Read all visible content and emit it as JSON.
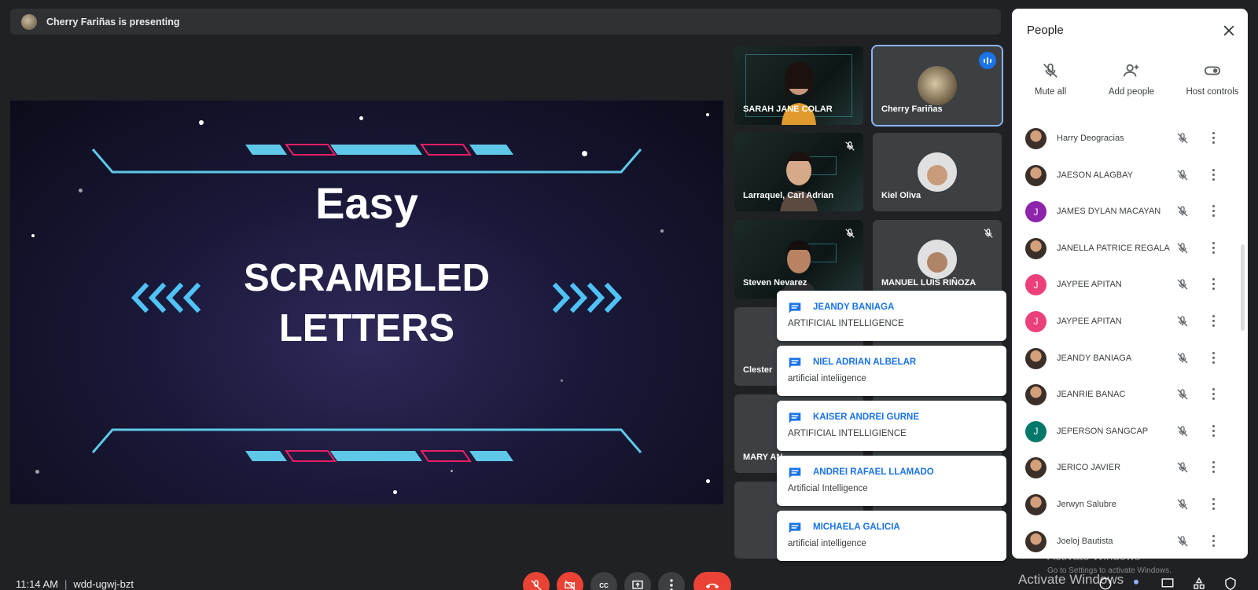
{
  "presenting_bar": {
    "text": "Cherry Fariñas is presenting"
  },
  "slide": {
    "title": "Easy",
    "line1": "SCRAMBLED",
    "line2": "LETTERS"
  },
  "tiles": [
    {
      "name": "SARAH JANE COLAR"
    },
    {
      "name": "Cherry Fariñas"
    },
    {
      "name": "Larraquel, Carl Adrian"
    },
    {
      "name": "Kiel Oliva"
    },
    {
      "name": "Steven Nevarez"
    },
    {
      "name": "MANUEL LUIS RIÑOZA"
    },
    {
      "name": "Clester"
    },
    {
      "name": "MARY AN"
    }
  ],
  "notifications": [
    {
      "name": "JEANDY BANIAGA",
      "message": "ARTIFICIAL INTELLIGENCE"
    },
    {
      "name": "NIEL ADRIAN ALBELAR",
      "message": "artificial inteliigence"
    },
    {
      "name": "KAISER ANDREI GURNE",
      "message": "ARTIFICIAL INTELLIGIENCE"
    },
    {
      "name": "ANDREI RAFAEL LLAMADO",
      "message": "Artificial Intelligence"
    },
    {
      "name": "MICHAELA GALICIA",
      "message": "artificial intelligence"
    }
  ],
  "people_panel": {
    "title": "People",
    "actions": {
      "mute_all": "Mute all",
      "add_people": "Add people",
      "host_controls": "Host controls"
    },
    "people": [
      {
        "name": "Harry Deogracias",
        "avatar": "photo",
        "initial": ""
      },
      {
        "name": "JAESON ALAGBAY",
        "avatar": "photo",
        "initial": ""
      },
      {
        "name": "JAMES DYLAN MACAYAN",
        "avatar": "initial",
        "initial": "J",
        "color": "#8e24aa"
      },
      {
        "name": "JANELLA PATRICE REGALA",
        "avatar": "photo",
        "initial": ""
      },
      {
        "name": "JAYPEE APITAN",
        "avatar": "initial",
        "initial": "J",
        "color": "#ec407a"
      },
      {
        "name": "JAYPEE APITAN",
        "avatar": "initial",
        "initial": "J",
        "color": "#ec407a"
      },
      {
        "name": "JEANDY BANIAGA",
        "avatar": "photo",
        "initial": ""
      },
      {
        "name": "JEANRIE BANAC",
        "avatar": "photo",
        "initial": ""
      },
      {
        "name": "JEPERSON SANGCAP",
        "avatar": "initial",
        "initial": "J",
        "color": "#00796b"
      },
      {
        "name": "JERICO JAVIER",
        "avatar": "photo",
        "initial": ""
      },
      {
        "name": "Jerwyn Salubre",
        "avatar": "photo",
        "initial": ""
      },
      {
        "name": "Joeloj Bautista",
        "avatar": "photo",
        "initial": ""
      }
    ]
  },
  "watermark": {
    "title": "Activate Windows",
    "subtitle": "Go to Settings to activate Windows.",
    "overlay": "Activate Windows"
  },
  "bottom_bar": {
    "time": "11:14 AM",
    "meeting_code": "wdd-ugwj-bzt",
    "cc_label": "CC"
  },
  "colors": {
    "accent": "#1a73e8",
    "danger": "#ea4335",
    "background": "#202124",
    "slide_cyan": "#4fc3f7",
    "slide_pink": "#e91e63"
  }
}
